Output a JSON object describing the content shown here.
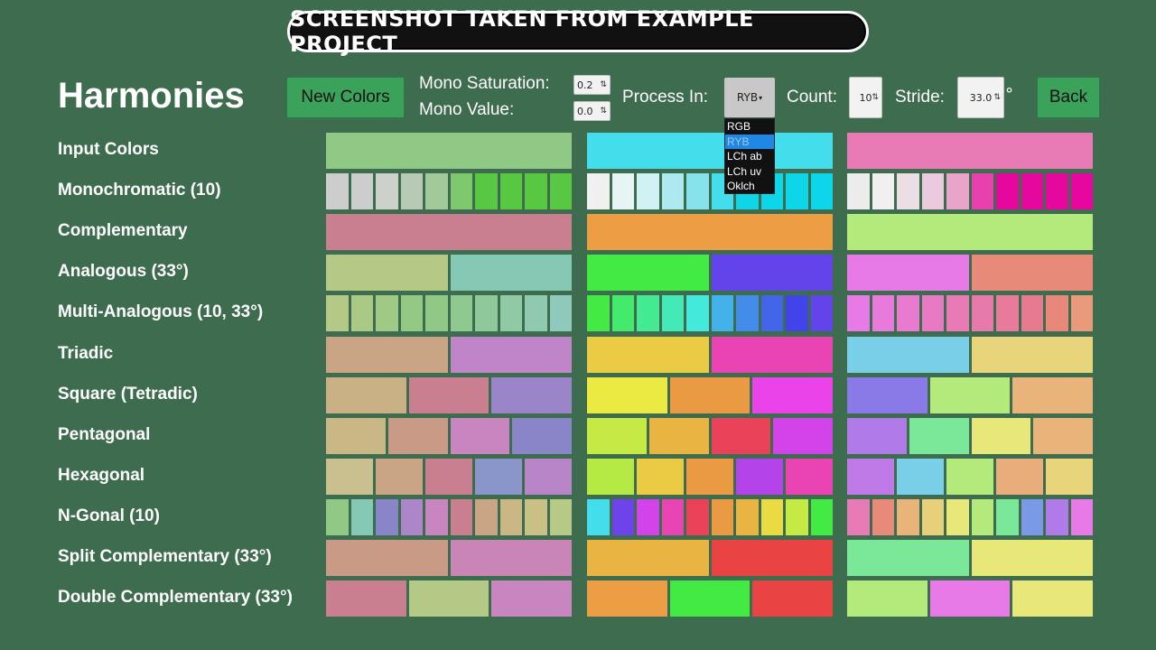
{
  "banner": "SCREENSHOT TAKEN FROM EXAMPLE PROJECT",
  "title": "Harmonies",
  "toolbar": {
    "new_colors": "New Colors",
    "mono_saturation_label": "Mono Saturation:",
    "mono_saturation_value": "0.2",
    "mono_value_label": "Mono Value:",
    "mono_value_value": "0.0",
    "process_in_label": "Process In:",
    "process_in_value": "RYB",
    "process_options": [
      "RGB",
      "RYB",
      "LCh ab",
      "LCh uv",
      "Oklch"
    ],
    "process_selected_index": 1,
    "count_label": "Count:",
    "count_value": "10",
    "stride_label": "Stride:",
    "stride_value": "33.0",
    "stride_unit": "°",
    "back": "Back"
  },
  "rows": [
    {
      "label": "Input Colors",
      "groups": [
        [
          "#8fc985"
        ],
        [
          "#43ddeb"
        ],
        [
          "#e87ab6"
        ]
      ]
    },
    {
      "label": "Monochromatic (10)",
      "groups": [
        [
          "#cdcdcd",
          "#cdcdcd",
          "#cdd1cc",
          "#b7cab3",
          "#a1c99a",
          "#7ec86e",
          "#58c743",
          "#58c742",
          "#58c742",
          "#58c742"
        ],
        [
          "#f0f0f0",
          "#e6f4f4",
          "#d0f2f4",
          "#ade9ef",
          "#86e3ec",
          "#43ddeb",
          "#10d5e7",
          "#0dd6e8",
          "#0dd6e8",
          "#0dd6e8"
        ],
        [
          "#ececec",
          "#f0f0f0",
          "#ebdfe5",
          "#eacadc",
          "#e9a5c9",
          "#e840ad",
          "#e6089e",
          "#e6089e",
          "#e6089e",
          "#e6089e"
        ]
      ]
    },
    {
      "label": "Complementary",
      "groups": [
        [
          "#c97f8f"
        ],
        [
          "#ed9d43"
        ],
        [
          "#b4ea7c"
        ]
      ]
    },
    {
      "label": "Analogous (33°)",
      "groups": [
        [
          "#b4c985",
          "#85c9b5"
        ],
        [
          "#43ea43",
          "#6343ea"
        ],
        [
          "#e87ae8",
          "#e88a7a"
        ]
      ]
    },
    {
      "label": "Multi-Analogous (10, 33°)",
      "groups": [
        [
          "#b4c985",
          "#a9c985",
          "#9fc985",
          "#94c985",
          "#8fc985",
          "#8fc98f",
          "#8fc99a",
          "#8fc9a5",
          "#8fc9af",
          "#8fc9bb"
        ],
        [
          "#43ea43",
          "#43ea6b",
          "#43ea92",
          "#43eab8",
          "#43eadc",
          "#43b2ea",
          "#438cea",
          "#4365ea",
          "#4343ea",
          "#6343ea"
        ],
        [
          "#e87ae8",
          "#e87adb",
          "#e87acf",
          "#e87ac3",
          "#e87ab6",
          "#e87aa9",
          "#e87a9c",
          "#e87a90",
          "#e8887a",
          "#e89a7a"
        ]
      ]
    },
    {
      "label": "Triadic",
      "groups": [
        [
          "#c9a585",
          "#c085c9"
        ],
        [
          "#eacb43",
          "#ea43b4"
        ],
        [
          "#7acfe8",
          "#e8d47a"
        ]
      ]
    },
    {
      "label": "Square (Tetradic)",
      "groups": [
        [
          "#c9b085",
          "#c97f8f",
          "#9a85c9"
        ],
        [
          "#eaea43",
          "#ea9a43",
          "#ea43ea"
        ],
        [
          "#8a7ae8",
          "#b4ea7c",
          "#e8b47a"
        ]
      ]
    },
    {
      "label": "Pentagonal",
      "groups": [
        [
          "#c9b885",
          "#c99a85",
          "#c985bf",
          "#8a85c9"
        ],
        [
          "#c4ea43",
          "#eab443",
          "#ea4359",
          "#d343ea"
        ],
        [
          "#b07ae8",
          "#7ae898",
          "#e8e87a",
          "#e8b47a"
        ]
      ]
    },
    {
      "label": "Hexagonal",
      "groups": [
        [
          "#c9bf8f",
          "#c9a585",
          "#c97f8f",
          "#8a96c9",
          "#b885c9"
        ],
        [
          "#b4ea43",
          "#eacb43",
          "#ea9a43",
          "#b543ea",
          "#ea43b4"
        ],
        [
          "#c07ae8",
          "#7acfe8",
          "#b4ea7c",
          "#e8ad7a",
          "#e8d47a"
        ]
      ]
    },
    {
      "label": "N-Gonal (10)",
      "groups": [
        [
          "#8fc985",
          "#85c9b5",
          "#8a85c9",
          "#ad85c9",
          "#c985bf",
          "#c97f8f",
          "#c9a585",
          "#c9b885",
          "#c9c085",
          "#b8c985"
        ],
        [
          "#43ddeb",
          "#6e43ea",
          "#d343ea",
          "#ea43b4",
          "#ea4359",
          "#ea9a43",
          "#eab443",
          "#eadb43",
          "#c4ea43",
          "#43ea43"
        ],
        [
          "#e87ab6",
          "#e88a7a",
          "#e8b47a",
          "#e8cf7a",
          "#e8e87a",
          "#b4ea7c",
          "#7ae898",
          "#7a9ae8",
          "#b07ae8",
          "#e87ae8"
        ]
      ]
    },
    {
      "label": "Split Complementary (33°)",
      "groups": [
        [
          "#c99a85",
          "#c985b5"
        ],
        [
          "#eab443",
          "#ea4343"
        ],
        [
          "#7ae898",
          "#e8e87a"
        ]
      ]
    },
    {
      "label": "Double Complementary (33°)",
      "groups": [
        [
          "#c97f8f",
          "#b4c985",
          "#c985bf"
        ],
        [
          "#ed9d43",
          "#43ea43",
          "#ea4343"
        ],
        [
          "#b4ea7c",
          "#e87ae8",
          "#e8e87a"
        ]
      ]
    }
  ]
}
